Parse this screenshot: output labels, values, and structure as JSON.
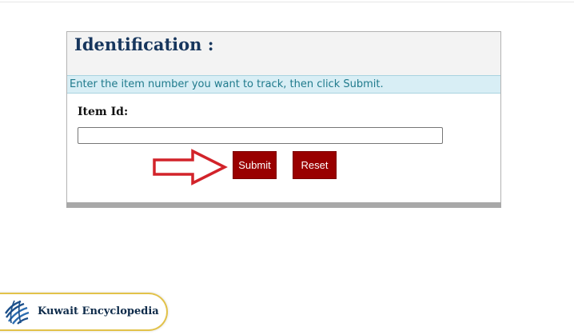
{
  "form": {
    "title": "Identification :",
    "instruction": "Enter the item number you want to track, then click Submit.",
    "item_label": "Item Id:",
    "item_value": "",
    "item_placeholder": "",
    "submit_label": "Submit",
    "reset_label": "Reset"
  },
  "branding": {
    "name": "Kuwait Encyclopedia",
    "logo_icon": "globe-logo-icon"
  },
  "annotation": {
    "icon": "right-arrow-icon",
    "color": "#d2232a"
  },
  "colors": {
    "title": "#17365d",
    "instruction_bg": "#d8eef5",
    "instruction_text": "#1f7a8c",
    "button_bg": "#990000",
    "brand_border": "#e2c24a"
  }
}
